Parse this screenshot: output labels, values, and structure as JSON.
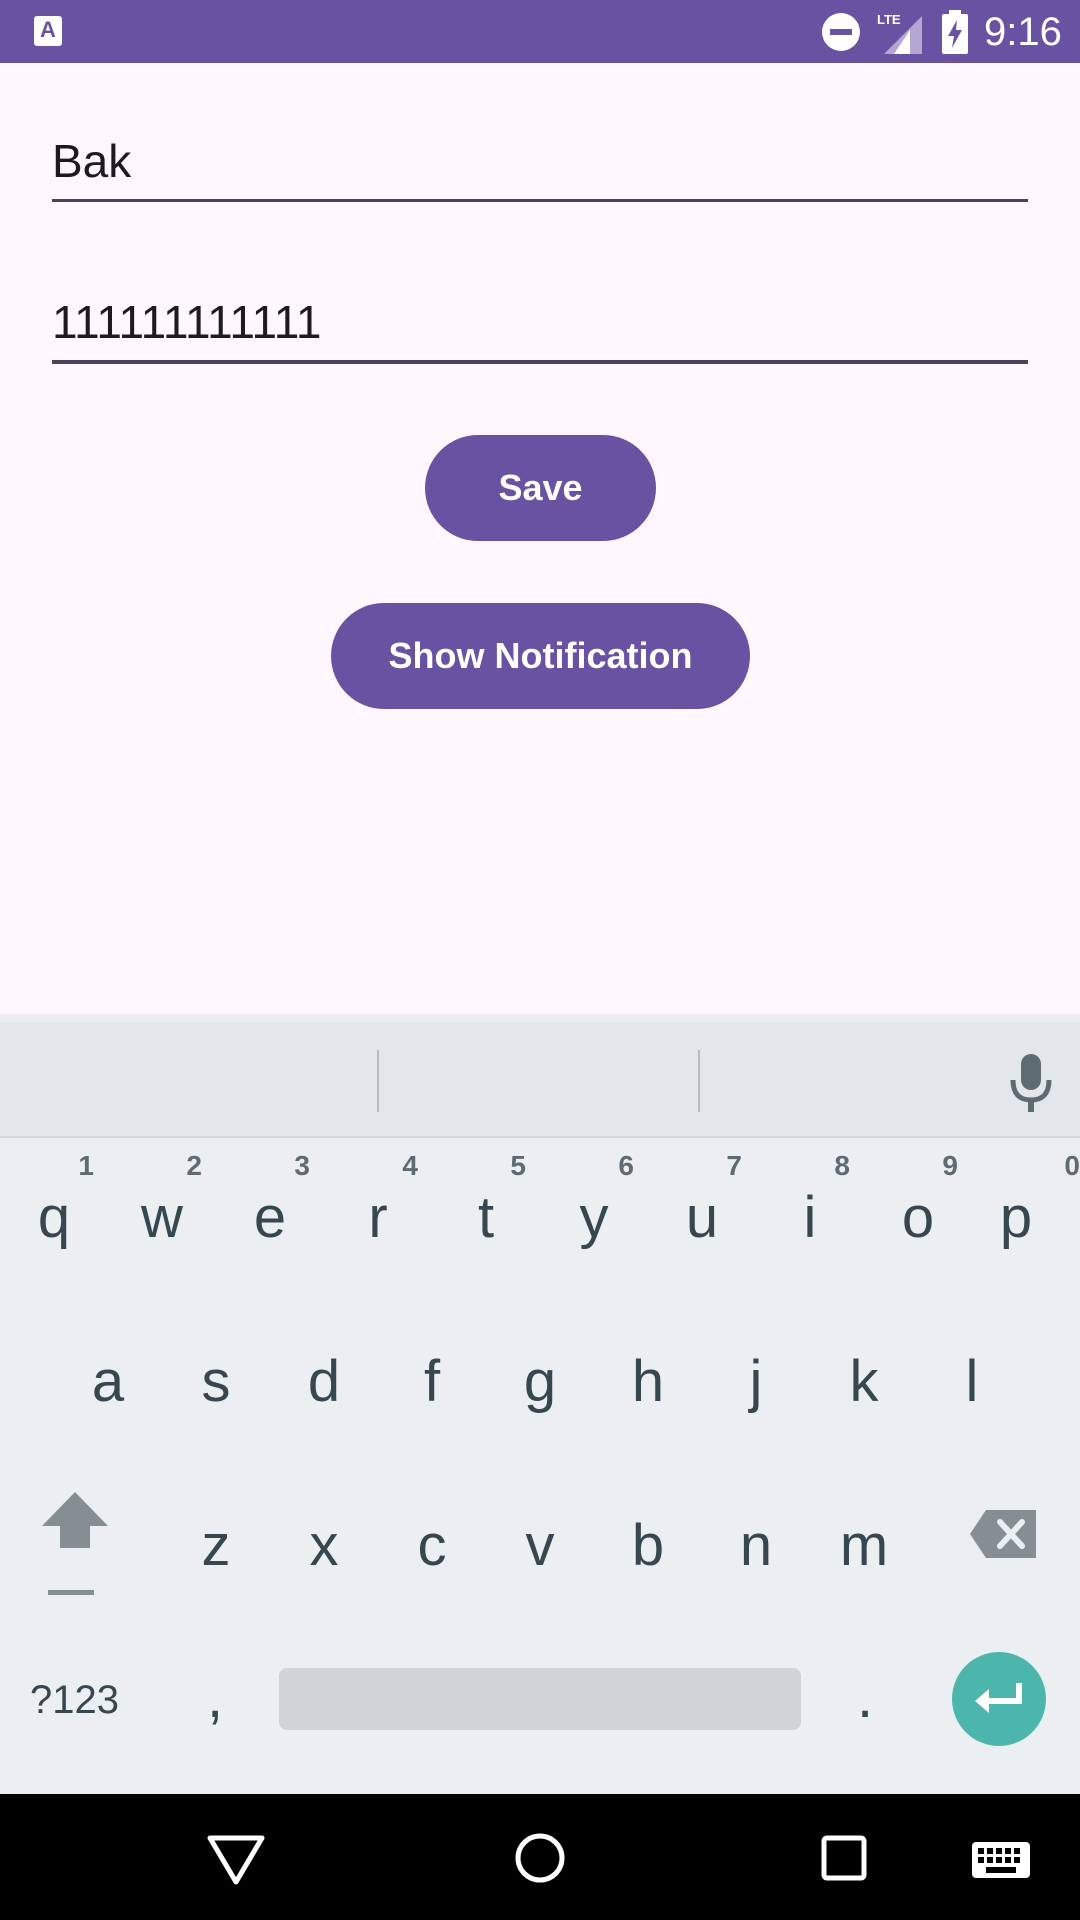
{
  "status_bar": {
    "time": "9:16",
    "network_label": "LTE",
    "app_icon_letter": "A",
    "icons": [
      "app-notification-icon",
      "do-not-disturb-icon",
      "lte-signal-icon",
      "battery-charging-icon"
    ]
  },
  "form": {
    "name_value": "Bak",
    "phone_value": "111111111111"
  },
  "buttons": {
    "save_label": "Save",
    "notify_label": "Show Notification"
  },
  "keyboard": {
    "row1": [
      {
        "key": "q",
        "hint": "1"
      },
      {
        "key": "w",
        "hint": "2"
      },
      {
        "key": "e",
        "hint": "3"
      },
      {
        "key": "r",
        "hint": "4"
      },
      {
        "key": "t",
        "hint": "5"
      },
      {
        "key": "y",
        "hint": "6"
      },
      {
        "key": "u",
        "hint": "7"
      },
      {
        "key": "i",
        "hint": "8"
      },
      {
        "key": "o",
        "hint": "9"
      },
      {
        "key": "p",
        "hint": "0"
      }
    ],
    "row2": [
      "a",
      "s",
      "d",
      "f",
      "g",
      "h",
      "j",
      "k",
      "l"
    ],
    "row3": [
      "z",
      "x",
      "c",
      "v",
      "b",
      "n",
      "m"
    ],
    "symbols_label": "?123",
    "comma_label": ",",
    "period_label": ".",
    "icons": [
      "microphone-icon",
      "shift-icon",
      "backspace-icon",
      "enter-icon"
    ]
  },
  "nav_bar": {
    "icons": [
      "back-icon",
      "home-icon",
      "recents-icon",
      "keyboard-switch-icon"
    ]
  },
  "colors": {
    "primary": "#6a52a3",
    "background": "#fef7fe",
    "keyboard_bg": "#eceff1",
    "enter_key": "#4db6ac",
    "key_text": "#37474f"
  }
}
